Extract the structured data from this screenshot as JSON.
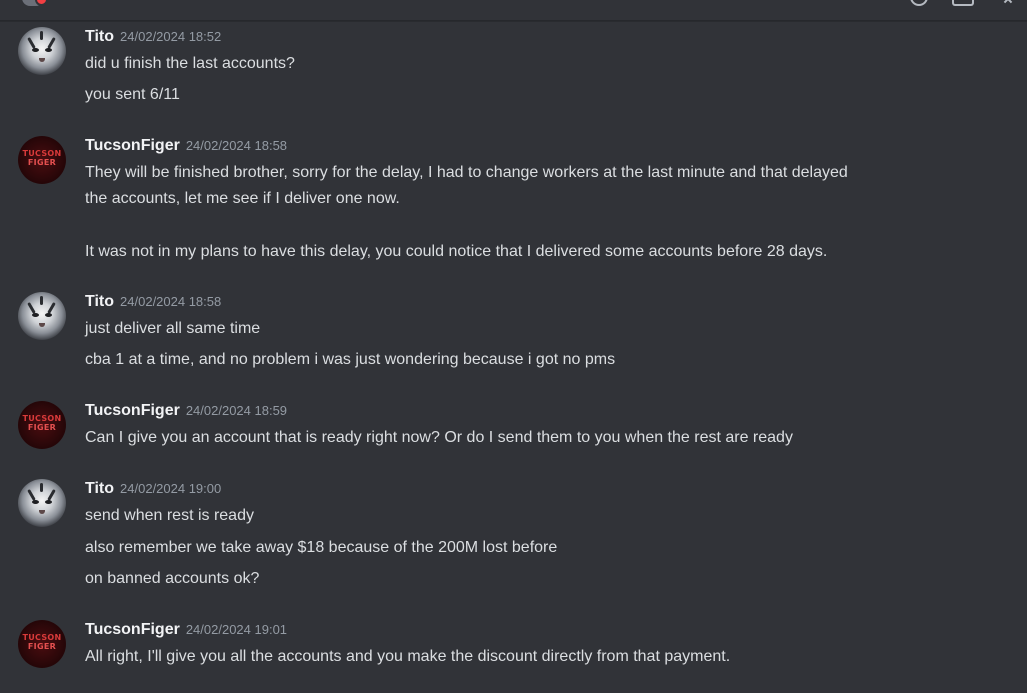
{
  "topbar": {
    "icons": [
      "user-avatar-icon",
      "notification-icon",
      "inbox-icon",
      "close-icon"
    ]
  },
  "colors": {
    "background": "#313338",
    "username": "#f2f3f5",
    "text": "#dbdee1",
    "timestamp": "#949ba4",
    "status_red": "#f23f43"
  },
  "avatars": {
    "tito": {
      "icon": "white-tiger-avatar"
    },
    "tucson": {
      "icon": "tucson-figer-logo-avatar",
      "logo_line1": "TUCSON",
      "logo_line2": "FIGER"
    }
  },
  "messages": [
    {
      "author": "Tito",
      "timestamp": "24/02/2024 18:52",
      "lines": [
        "did u finish the last accounts?",
        "you sent 6/11"
      ]
    },
    {
      "author": "TucsonFiger",
      "timestamp": "24/02/2024 18:58",
      "lines": [
        "They will be finished brother, sorry for the delay, I had to change workers at the last minute and that delayed",
        "the accounts, let me see if I deliver one now.",
        "It was not in my plans to have this delay, you could notice that I delivered some accounts before 28 days."
      ]
    },
    {
      "author": "Tito",
      "timestamp": "24/02/2024 18:58",
      "lines": [
        "just deliver all same time",
        "cba 1 at a time, and no problem i was just wondering because i got no pms"
      ]
    },
    {
      "author": "TucsonFiger",
      "timestamp": "24/02/2024 18:59",
      "lines": [
        "Can I give you an account that is ready right now? Or do I send them to you when the rest are ready"
      ]
    },
    {
      "author": "Tito",
      "timestamp": "24/02/2024 19:00",
      "lines": [
        "send when rest is ready",
        "also remember we take away $18 because of the 200M lost before",
        "on banned accounts ok?"
      ]
    },
    {
      "author": "TucsonFiger",
      "timestamp": "24/02/2024 19:01",
      "lines": [
        "All right, I'll give you all the accounts and you make the discount directly from that payment."
      ]
    }
  ]
}
